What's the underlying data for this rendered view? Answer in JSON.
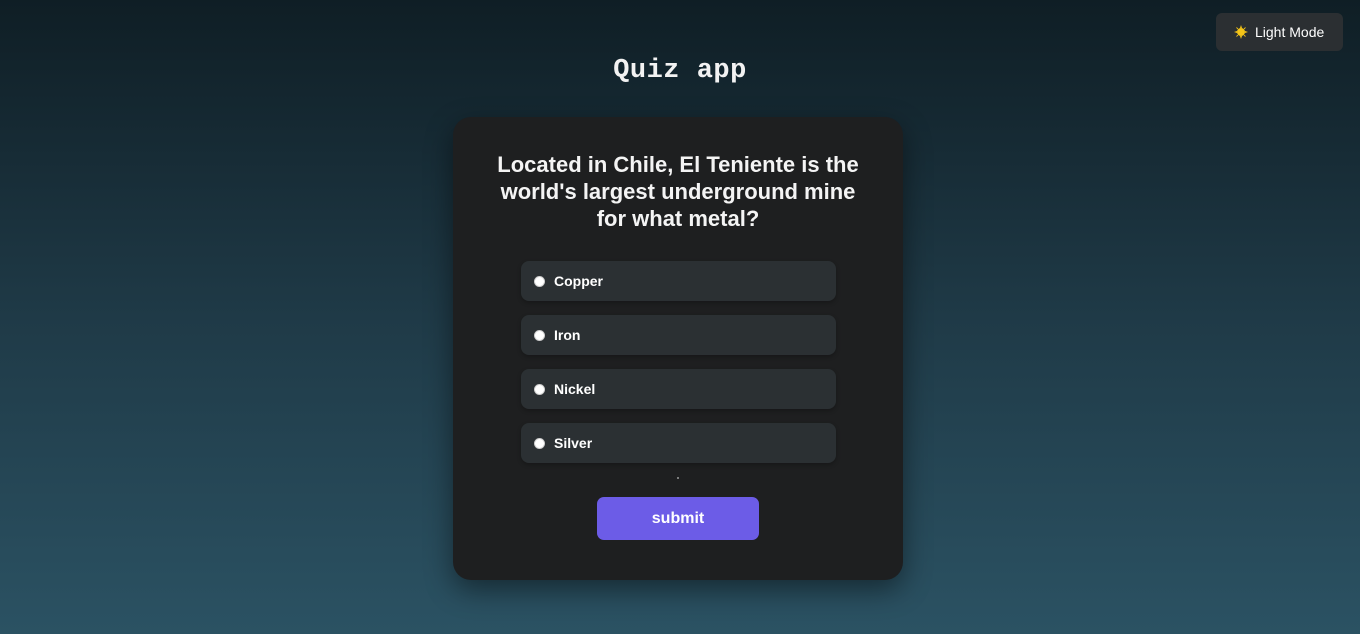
{
  "theme_toggle": {
    "label": "Light Mode",
    "icon": "sun-icon"
  },
  "app": {
    "title": "Quiz app"
  },
  "quiz": {
    "question": "Located in Chile, El Teniente is the world's largest underground mine for what metal?",
    "options": [
      {
        "label": "Copper"
      },
      {
        "label": "Iron"
      },
      {
        "label": "Nickel"
      },
      {
        "label": "Silver"
      }
    ],
    "submit_label": "submit"
  },
  "colors": {
    "accent": "#6c5ce7",
    "card_background": "#1e1f20",
    "option_background": "#2b3033",
    "sun": "#f5c518"
  }
}
